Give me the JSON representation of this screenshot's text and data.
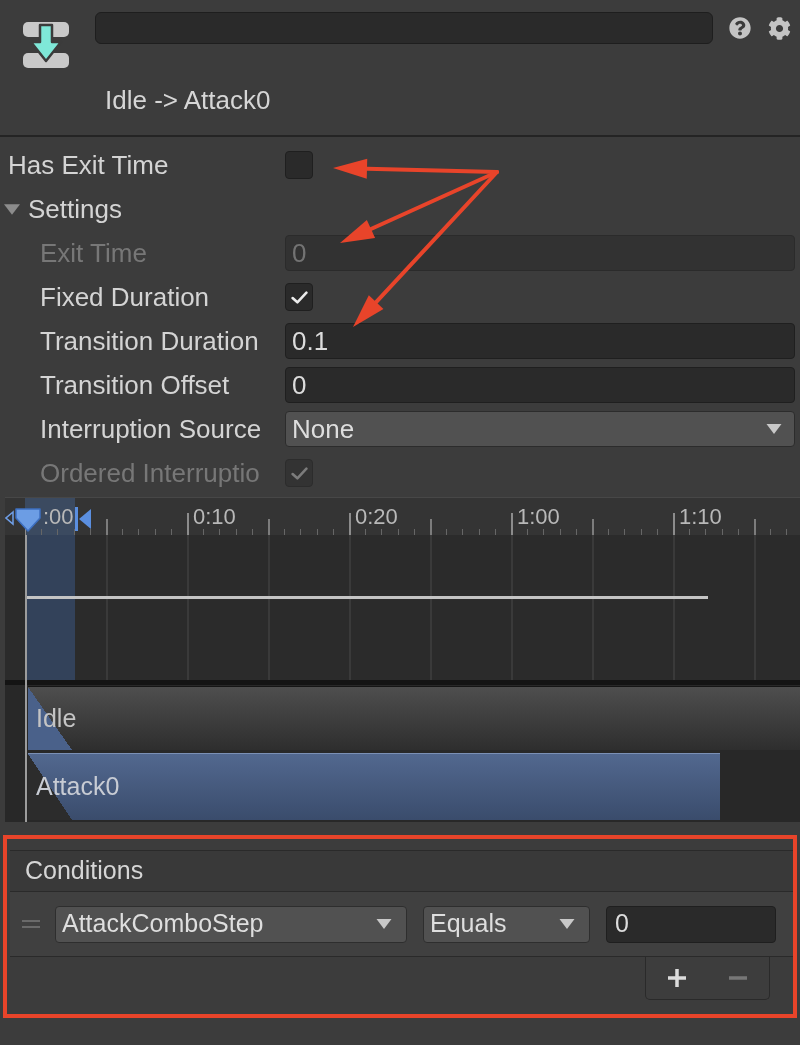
{
  "header": {
    "title": "Idle -> Attack0"
  },
  "has_exit_time": {
    "label": "Has Exit Time",
    "checked": false
  },
  "settings": {
    "label": "Settings",
    "expanded": true,
    "fields": [
      {
        "kind": "number",
        "label": "Exit Time",
        "value": "0",
        "disabled": true
      },
      {
        "kind": "checkbox",
        "label": "Fixed Duration",
        "checked": true,
        "disabled": false
      },
      {
        "kind": "number",
        "label": "Transition Duration",
        "value": "0.1",
        "disabled": false
      },
      {
        "kind": "number",
        "label": "Transition Offset",
        "value": "0",
        "disabled": false
      },
      {
        "kind": "dropdown",
        "label": "Interruption Source",
        "value": "None",
        "disabled": false
      },
      {
        "kind": "checkbox",
        "label": "Ordered Interruptio",
        "checked": true,
        "disabled": true
      }
    ]
  },
  "timeline": {
    "ruler_labels": [
      ":00",
      "0:10",
      "0:20",
      "1:00",
      "1:10"
    ],
    "tracks": [
      {
        "kind": "source",
        "label": "Idle"
      },
      {
        "kind": "destination",
        "label": "Attack0"
      }
    ]
  },
  "conditions": {
    "title": "Conditions",
    "highlighted": true,
    "rows": [
      {
        "parameter": "AttackComboStep",
        "mode": "Equals",
        "value": "0"
      }
    ],
    "footer_buttons": [
      {
        "kind": "add",
        "disabled": false
      },
      {
        "kind": "remove",
        "disabled": true
      }
    ]
  }
}
